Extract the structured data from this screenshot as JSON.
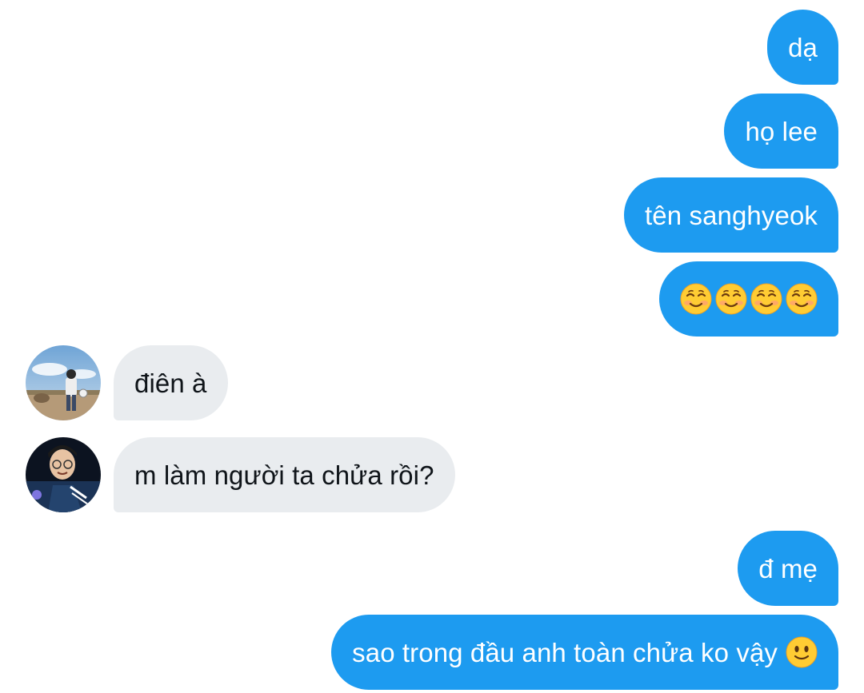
{
  "messages": [
    {
      "side": "out",
      "text": "dạ"
    },
    {
      "side": "out",
      "text": "họ lee"
    },
    {
      "side": "out",
      "text": "tên sanghyeok"
    },
    {
      "side": "out",
      "emoji": [
        "smiling-face-icon",
        "smiling-face-icon",
        "smiling-face-icon",
        "smiling-face-icon"
      ]
    },
    {
      "side": "in",
      "text": "điên à",
      "avatar": "avatar-outdoor"
    },
    {
      "side": "in",
      "text": "m làm người ta chửa rồi?",
      "avatar": "avatar-glasses"
    },
    {
      "side": "out",
      "text": "đ mẹ"
    },
    {
      "side": "out",
      "text": "sao trong đầu anh toàn chửa ko vậy",
      "emoji": [
        "slightly-smiling-face-icon"
      ]
    }
  ],
  "colors": {
    "outgoing_bubble": "#1d9bf0",
    "incoming_bubble": "#e9ecef",
    "background": "#ffffff"
  }
}
